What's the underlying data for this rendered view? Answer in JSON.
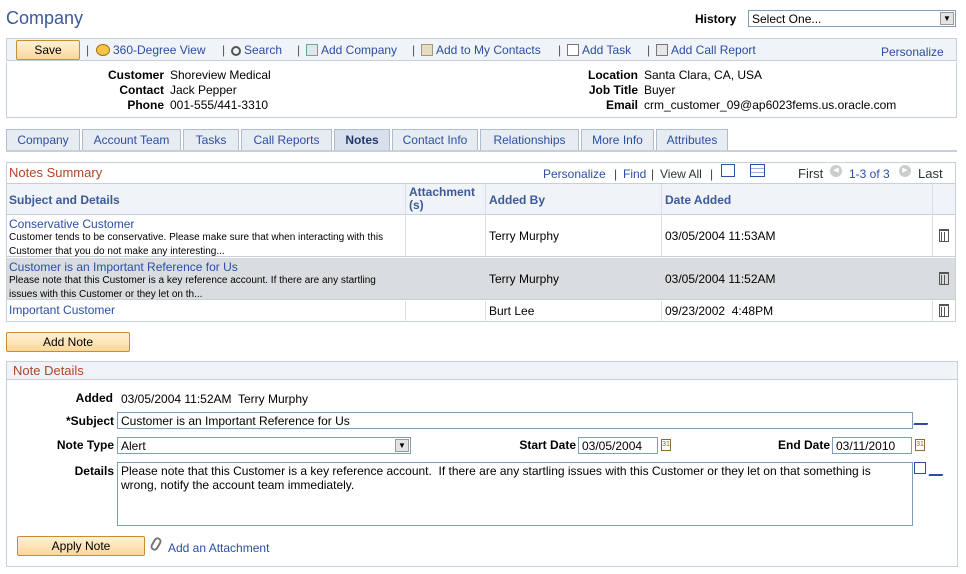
{
  "page": {
    "title": "Company"
  },
  "history": {
    "label": "History",
    "selected": "Select One..."
  },
  "toolbar": {
    "save": "Save",
    "view360": "360-Degree View",
    "search": "Search",
    "add_company": "Add Company",
    "add_contacts": "Add to My Contacts",
    "add_task": "Add Task",
    "add_call_report": "Add Call Report",
    "personalize": "Personalize"
  },
  "info": {
    "customer_label": "Customer",
    "customer": "Shoreview Medical",
    "contact_label": "Contact",
    "contact": "Jack Pepper",
    "phone_label": "Phone",
    "phone": "001-555/441-3310",
    "location_label": "Location",
    "location": "Santa Clara, CA, USA",
    "jobtitle_label": "Job Title",
    "jobtitle": "Buyer",
    "email_label": "Email",
    "email": "crm_customer_09@ap6023fems.us.oracle.com"
  },
  "tabs": [
    "Company",
    "Account Team",
    "Tasks",
    "Call Reports",
    "Notes",
    "Contact Info",
    "Relationships",
    "More Info",
    "Attributes"
  ],
  "grid": {
    "title": "Notes Summary",
    "personalize": "Personalize",
    "find": "Find",
    "view_all": "View All",
    "first": "First",
    "range": "1-3 of 3",
    "last": "Last",
    "columns": [
      "Subject and Details",
      "Attachment (s)",
      "Added By",
      "Date Added"
    ],
    "rows": [
      {
        "subject": "Conservative Customer",
        "details": "Customer tends to be conservative. Please make sure that when interacting with this Customer that you do not make any interesting...",
        "added_by": "Terry Murphy",
        "date": "03/05/2004 11:53AM"
      },
      {
        "subject": "Customer is an Important Reference for Us",
        "details": "Please note that this Customer is a key reference account. If there are any startling issues with this Customer or they let on th...",
        "added_by": "Terry Murphy",
        "date": "03/05/2004 11:52AM"
      },
      {
        "subject": "Important Customer",
        "details": "",
        "added_by": "Burt Lee",
        "date": "09/23/2002  4:48PM"
      }
    ]
  },
  "add_note": "Add Note",
  "note_details": {
    "title": "Note Details",
    "added_label": "Added",
    "added_value": "03/05/2004 11:52AM  Terry Murphy",
    "subject_label": "*Subject",
    "subject_value": "Customer is an Important Reference for Us",
    "type_label": "Note Type",
    "type_value": "Alert",
    "start_label": "Start Date",
    "start_value": "03/05/2004",
    "end_label": "End Date",
    "end_value": "03/11/2010",
    "details_label": "Details",
    "details_value": "Please note that this Customer is a key reference account.  If there are any startling issues with this Customer or they let on that something is wrong, notify the account team immediately.",
    "apply": "Apply Note",
    "attach": "Add an Attachment"
  }
}
